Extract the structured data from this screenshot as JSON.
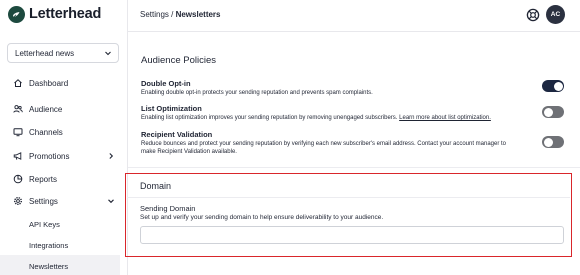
{
  "app": {
    "name": "Letterhead",
    "brand_color": "#1d4a3f"
  },
  "org_selector": {
    "value": "Letterhead news"
  },
  "nav": {
    "items": [
      {
        "label": "Dashboard",
        "icon": "home-icon"
      },
      {
        "label": "Audience",
        "icon": "users-icon"
      },
      {
        "label": "Channels",
        "icon": "monitor-icon"
      },
      {
        "label": "Promotions",
        "icon": "megaphone-icon"
      },
      {
        "label": "Reports",
        "icon": "chart-pie-icon"
      },
      {
        "label": "Settings",
        "icon": "gear-icon"
      }
    ],
    "settings_sub": [
      "API Keys",
      "Integrations",
      "Newsletters"
    ],
    "active": "Newsletters"
  },
  "header": {
    "breadcrumb_parent": "Settings",
    "breadcrumb_sep": " / ",
    "breadcrumb_current": "Newsletters",
    "avatar_initials": "AC"
  },
  "audience_policies": {
    "title": "Audience Policies",
    "items": [
      {
        "title": "Double Opt-in",
        "desc": "Enabling double opt-in protects your sending reputation and prevents spam complaints.",
        "enabled": true
      },
      {
        "title": "List Optimization",
        "desc": "Enabling list optimization improves your sending reputation by removing unengaged subscribers.",
        "link": "Learn more about list optimization.",
        "enabled": false
      },
      {
        "title": "Recipient Validation",
        "desc_line1": "Reduce bounces and protect your sending reputation by verifying each new subscriber's email address. Contact your account manager to",
        "desc_line2": "make Recipient Validation available.",
        "enabled": false
      }
    ]
  },
  "domain": {
    "title": "Domain",
    "field_label": "Sending Domain",
    "field_desc": "Set up and verify your sending domain to help ensure deliverability to your audience.",
    "field_value": "",
    "highlight_color": "#d9262b"
  }
}
